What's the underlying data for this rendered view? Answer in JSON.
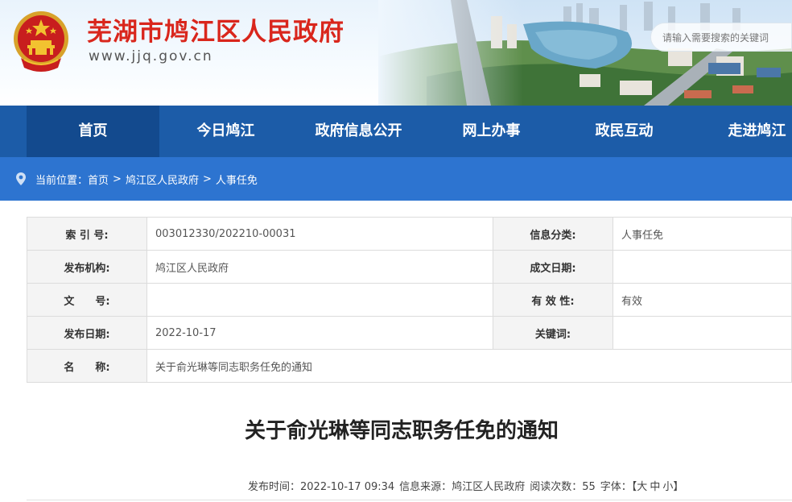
{
  "header": {
    "site_title": "芜湖市鸠江区人民政府",
    "site_url": "www.jjq.gov.cn",
    "search_placeholder": "请输入需要搜索的关键词"
  },
  "nav": {
    "items": [
      {
        "label": "首页",
        "active": true
      },
      {
        "label": "今日鸠江"
      },
      {
        "label": "政府信息公开"
      },
      {
        "label": "网上办事"
      },
      {
        "label": "政民互动"
      },
      {
        "label": "走进鸠江"
      }
    ]
  },
  "breadcrumb": {
    "prefix": "当前位置：",
    "items": [
      "首页",
      "鸠江区人民政府",
      "人事任免"
    ],
    "separator": ">"
  },
  "meta_table": {
    "index_label": "索 引 号:",
    "index_value": "003012330/202210-00031",
    "category_label": "信息分类:",
    "category_value": "人事任免",
    "publisher_label": "发布机构:",
    "publisher_value": "鸠江区人民政府",
    "created_label": "成文日期:",
    "created_value": "",
    "docno_label": "文　　号:",
    "docno_value": "",
    "validity_label": "有 效 性:",
    "validity_value": "有效",
    "pubdate_label": "发布日期:",
    "pubdate_value": "2022-10-17",
    "keywords_label": "关键词:",
    "keywords_value": "",
    "name_label": "名　　称:",
    "name_value": "关于俞光琳等同志职务任免的通知"
  },
  "article": {
    "title": "关于俞光琳等同志职务任免的通知",
    "meta": {
      "time_label": "发布时间：",
      "time_value": "2022-10-17 09:34",
      "source_label": "信息来源：",
      "source_value": "鸠江区人民政府",
      "views_label": "阅读次数：",
      "views_value": "55",
      "font_label": "字体：",
      "font_open": "【",
      "font_large": "大",
      "font_medium": "中",
      "font_small": "小",
      "font_close": "】"
    }
  },
  "colors": {
    "nav_bg": "#1c5ca8",
    "nav_active": "#134a8e",
    "breadcrumb_bg": "#2d74d0",
    "title_red": "#d9261c"
  }
}
